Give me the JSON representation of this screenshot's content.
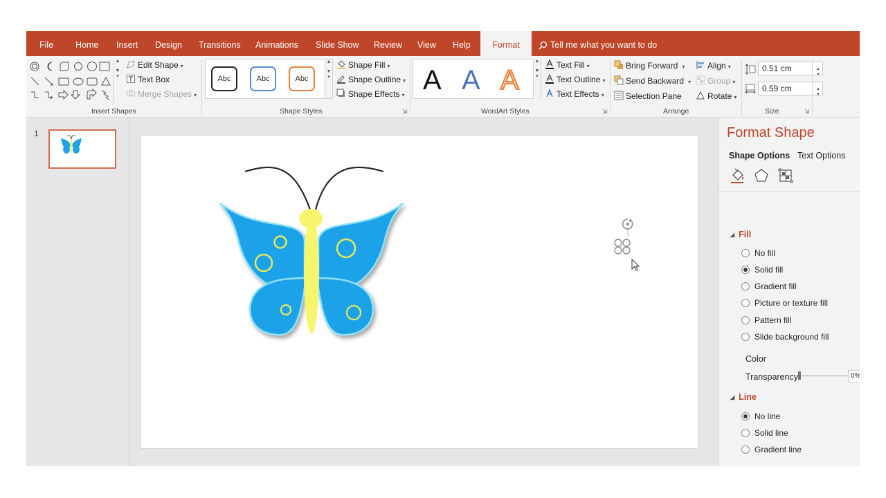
{
  "tabs": [
    {
      "label": "File",
      "active": false
    },
    {
      "label": "Home",
      "active": false
    },
    {
      "label": "Insert",
      "active": false
    },
    {
      "label": "Design",
      "active": false
    },
    {
      "label": "Transitions",
      "active": false
    },
    {
      "label": "Animations",
      "active": false
    },
    {
      "label": "Slide Show",
      "active": false
    },
    {
      "label": "Review",
      "active": false
    },
    {
      "label": "View",
      "active": false
    },
    {
      "label": "Help",
      "active": false
    },
    {
      "label": "Format",
      "active": true
    }
  ],
  "tell_me": "Tell me what you want to do",
  "ribbon": {
    "insert_shapes": {
      "label": "Insert Shapes",
      "edit_shape": "Edit Shape",
      "text_box": "Text Box",
      "merge_shapes": "Merge Shapes"
    },
    "shape_styles": {
      "label": "Shape Styles",
      "samples": [
        "Abc",
        "Abc",
        "Abc"
      ],
      "sample_colors": [
        "#262626",
        "#5b8ad4",
        "#e8823c"
      ],
      "shape_fill": "Shape Fill",
      "shape_outline": "Shape Outline",
      "shape_effects": "Shape Effects"
    },
    "wordart": {
      "label": "WordArt Styles",
      "samples": [
        "A",
        "A",
        "A"
      ],
      "text_fill": "Text Fill",
      "text_outline": "Text Outline",
      "text_effects": "Text Effects"
    },
    "arrange": {
      "label": "Arrange",
      "bring_forward": "Bring Forward",
      "send_backward": "Send Backward",
      "selection_pane": "Selection Pane",
      "align": "Align",
      "group": "Group",
      "rotate": "Rotate"
    },
    "size": {
      "label": "Size",
      "height": "0.51 cm",
      "width": "0.59 cm"
    }
  },
  "thumbnails": {
    "slide_number": "1"
  },
  "format_pane": {
    "title": "Format Shape",
    "tabs": [
      "Shape Options",
      "Text Options"
    ],
    "fill": {
      "heading": "Fill",
      "options": [
        {
          "label": "No fill",
          "selected": false
        },
        {
          "label": "Solid fill",
          "selected": true
        },
        {
          "label": "Gradient fill",
          "selected": false
        },
        {
          "label": "Picture or texture fill",
          "selected": false
        },
        {
          "label": "Pattern fill",
          "selected": false
        },
        {
          "label": "Slide background fill",
          "selected": false
        }
      ],
      "color_label": "Color",
      "transparency_label": "Transparency",
      "transparency_value": "0%",
      "transparency_level": 0
    },
    "line": {
      "heading": "Line",
      "options": [
        {
          "label": "No line",
          "selected": true
        },
        {
          "label": "Solid line",
          "selected": false
        },
        {
          "label": "Gradient line",
          "selected": false
        }
      ]
    }
  },
  "colors": {
    "accent": "#c0462a",
    "wing_blue": "#1fa2e8",
    "wing_light": "#8fe0f7",
    "body_yellow": "#f7f56e",
    "spot_yellow": "#e8e85a"
  },
  "icons": [
    "search-icon",
    "fill-bucket-icon",
    "pentagon-icon",
    "size-properties-icon",
    "rotate-handle-icon",
    "mouse-pointer-icon"
  ]
}
